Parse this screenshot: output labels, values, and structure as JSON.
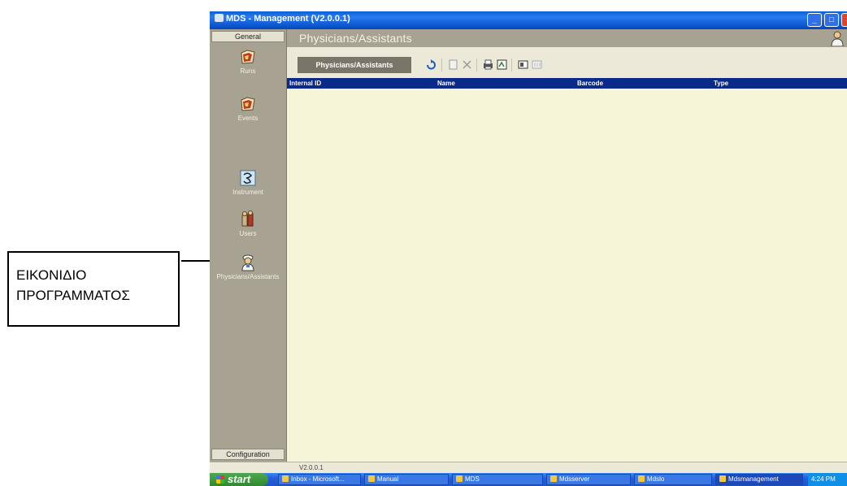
{
  "annotation": {
    "line1": "ΕΙΚΟΝΙΔΙΟ",
    "line2": "ΠΡΟΓΡΑΜΜΑΤΟΣ"
  },
  "window": {
    "title": "MDS - Management   (V2.0.0.1)",
    "min_symbol": "_",
    "max_symbol": "□",
    "close_symbol": "×"
  },
  "sidebar": {
    "general_label": "General",
    "configuration_label": "Configuration",
    "items": [
      {
        "label": "Runs",
        "icon": "folder-icon"
      },
      {
        "label": "Events",
        "icon": "folder-icon"
      },
      {
        "label": "Instrument",
        "icon": "instrument-icon"
      },
      {
        "label": "Users",
        "icon": "users-icon"
      },
      {
        "label": "Physicians/Assistants",
        "icon": "physician-icon"
      }
    ]
  },
  "main": {
    "title": "Physicians/Assistants",
    "tab_label": "Physicians/Assistants",
    "columns": [
      "Internal ID",
      "Name",
      "Barcode",
      "Type"
    ]
  },
  "toolbar": {
    "buttons": [
      "refresh-icon",
      "new-icon",
      "delete-icon",
      "print-icon",
      "export-icon",
      "import-icon",
      "disabled-icon"
    ]
  },
  "statusbar": {
    "text": "V2.0.0.1"
  },
  "taskbar": {
    "start_label": "start",
    "tasks": [
      "Inbox - Microsoft...",
      "Manual",
      "MDS",
      "Mdsserver",
      "Mdslo",
      "Mdsmanagement"
    ],
    "clock": "4:24 PM"
  },
  "colors": {
    "title_bar": "#0b56cf",
    "sidebar": "#a8a292",
    "grid_header": "#0a2a8a",
    "grid_body": "#f7f5d8"
  }
}
